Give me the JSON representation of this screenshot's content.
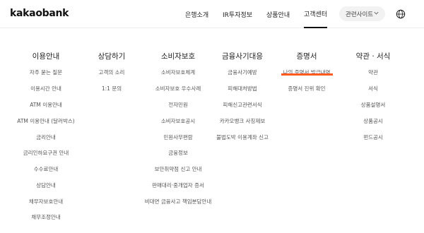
{
  "logo": "kakaobank",
  "nav": [
    "은행소개",
    "IR투자정보",
    "상품안내",
    "고객센터"
  ],
  "related_sites": "관련사이트",
  "icons": {
    "chevron": "chevron-down-icon",
    "globe": "globe-icon"
  },
  "accent_color": "#ff5a1f",
  "columns": [
    {
      "title": "이용안내",
      "items": [
        "자주 묻는 질문",
        "이용시간 안내",
        "ATM 이용안내",
        "ATM 이용안내 (달러박스)",
        "금리안내",
        "금리인하요구권 안내",
        "수수료안내",
        "상담안내",
        "채무자보호안내",
        "채무조정안내"
      ]
    },
    {
      "title": "상담하기",
      "items": [
        "고객의 소리",
        "1:1 문의"
      ]
    },
    {
      "title": "소비자보호",
      "items": [
        "소비자보호체계",
        "소비자보호 우수사례",
        "전자민원",
        "소비자보호공시",
        "민원사무편람",
        "금융정보",
        "보안취약점 신고 안내",
        "판매대리·중개업자 증서",
        "비대면 금융사고 책임분담안내"
      ]
    },
    {
      "title": "금융사기대응",
      "items": [
        "금융사기예방",
        "피해대처방법",
        "피해신고관련서식",
        "카카오뱅크 사칭제보",
        "불법도박 이용계좌 신고"
      ]
    },
    {
      "title": "증명서",
      "items": [
        "나의 증명서 발급내역",
        "증명서 진위 확인"
      ]
    },
    {
      "title": "약관 · 서식",
      "items": [
        "약관",
        "서식",
        "상품설명서",
        "상품공시",
        "펀드공시"
      ]
    }
  ]
}
